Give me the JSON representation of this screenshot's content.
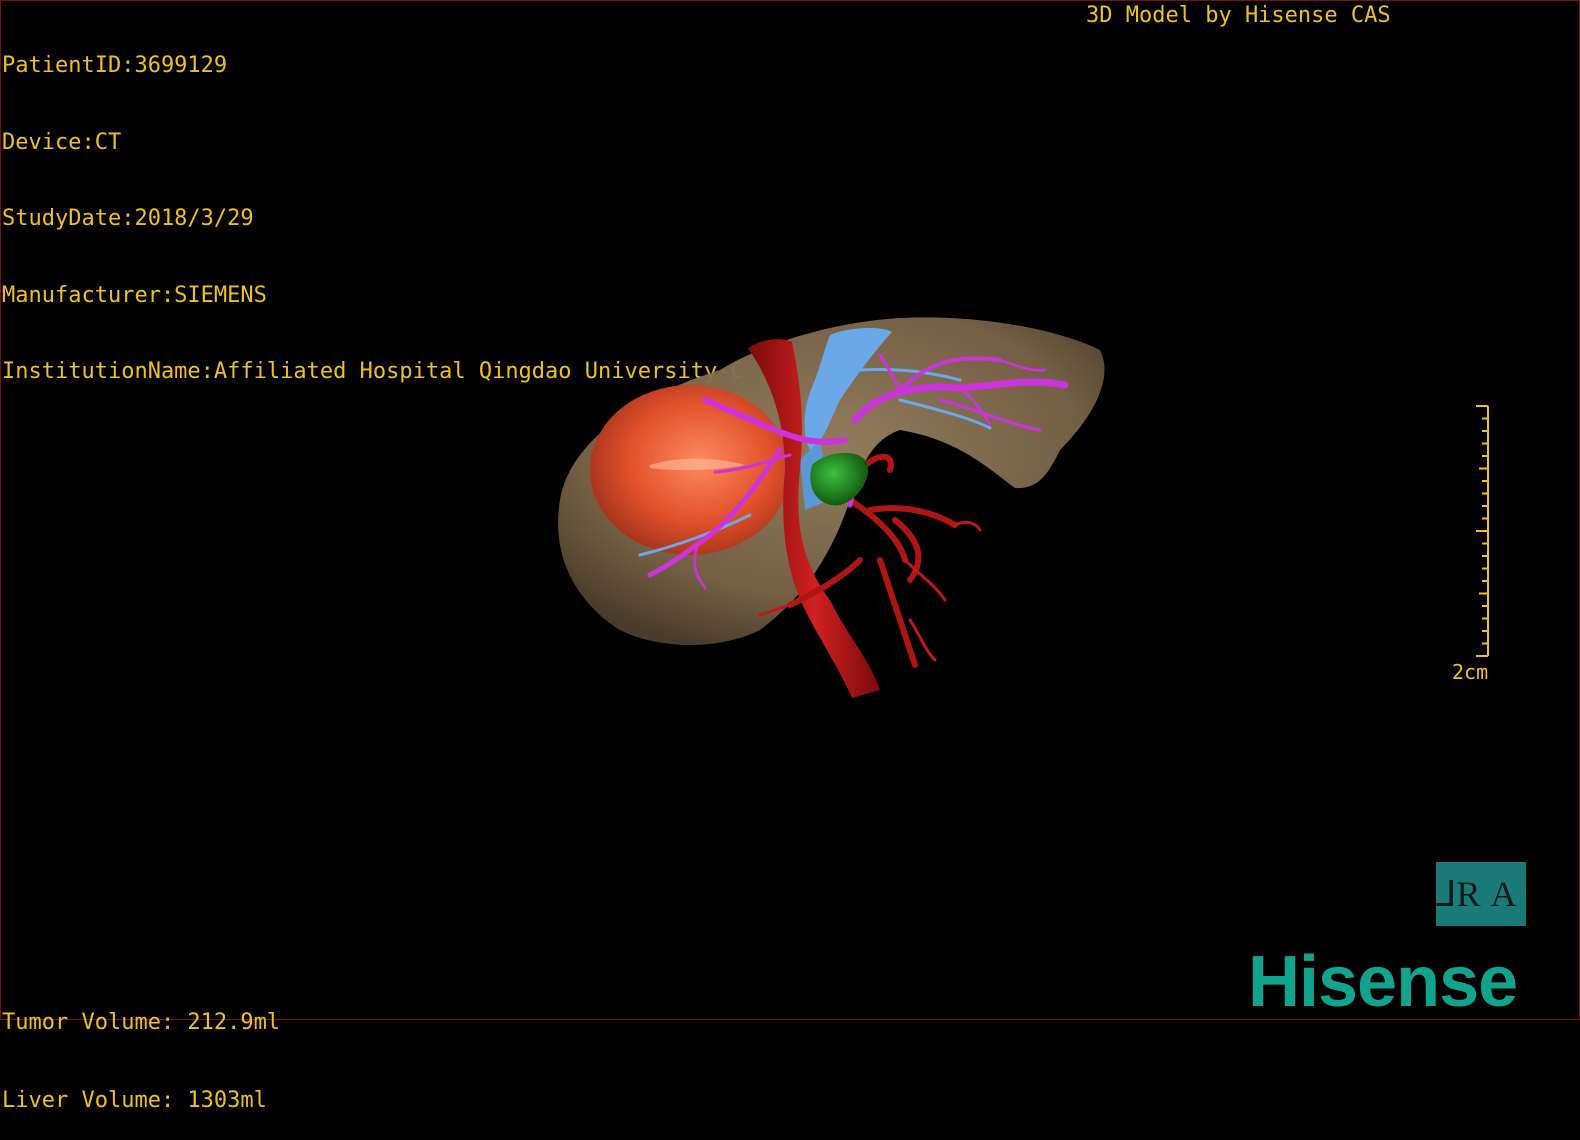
{
  "header": {
    "patient_id": "PatientID:3699129",
    "device": "Device:CT",
    "study_date": "StudyDate:2018/3/29",
    "manufacturer": "Manufacturer:SIEMENS",
    "institution": "InstitutionName:Affiliated Hospital Qingdao University-C",
    "credit": "3D Model by Hisense CAS"
  },
  "volumes": {
    "tumor": "Tumor Volume: 212.9ml",
    "liver": "Liver Volume: 1303ml"
  },
  "scale_bar": {
    "label": "2cm"
  },
  "orientation": {
    "left_glyph": "⅃R",
    "right_glyph": "A"
  },
  "logo": {
    "text": "Hisense",
    "color": "#12a38e"
  },
  "colors": {
    "text": "#f0c020",
    "liver": "#8a7355",
    "tumor": "#e0502a",
    "artery": "#b01515",
    "portal_vein": "#cc33dd",
    "hepatic_vein": "#6aa8e8",
    "gallbladder": "#1f8a1f"
  }
}
